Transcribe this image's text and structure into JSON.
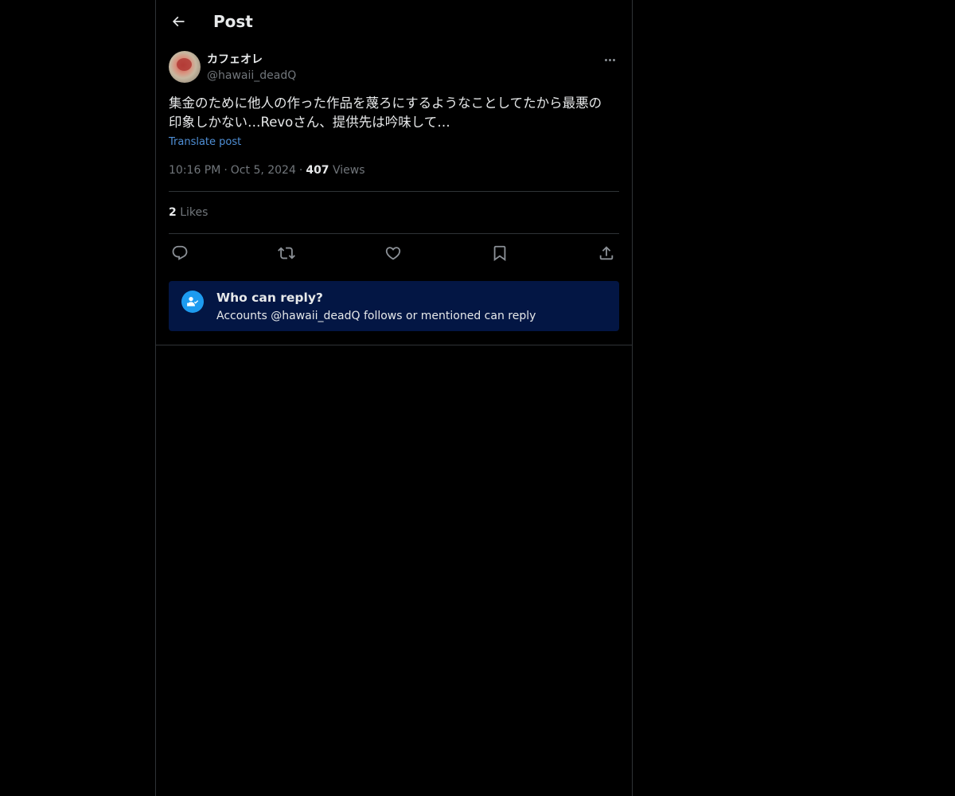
{
  "header": {
    "title": "Post"
  },
  "post": {
    "author": {
      "display_name": "カフェオレ",
      "handle": "@hawaii_deadQ"
    },
    "text_line1": "集金のために他人の作った作品を蔑ろにするようなことしてたから最悪の",
    "text_line2": "印象しかない…Revoさん、提供先は吟味して…",
    "translate_label": "Translate post",
    "time": "10:16 PM",
    "date": "Oct 5, 2024",
    "views_count": "407",
    "views_label": "Views",
    "likes_count": "2",
    "likes_label": "Likes"
  },
  "actions": [
    "reply-icon",
    "repost-icon",
    "like-icon",
    "bookmark-icon",
    "share-icon"
  ],
  "reply_restriction": {
    "title": "Who can reply?",
    "subtitle": "Accounts @hawaii_deadQ follows or mentioned can reply"
  },
  "colors": {
    "background": "#000000",
    "text_primary": "#e7e9ea",
    "text_secondary": "#71767b",
    "link": "#4f8fd6",
    "accent": "#1d9bf0",
    "reply_box_bg": "#031644",
    "border": "#2f3336"
  }
}
